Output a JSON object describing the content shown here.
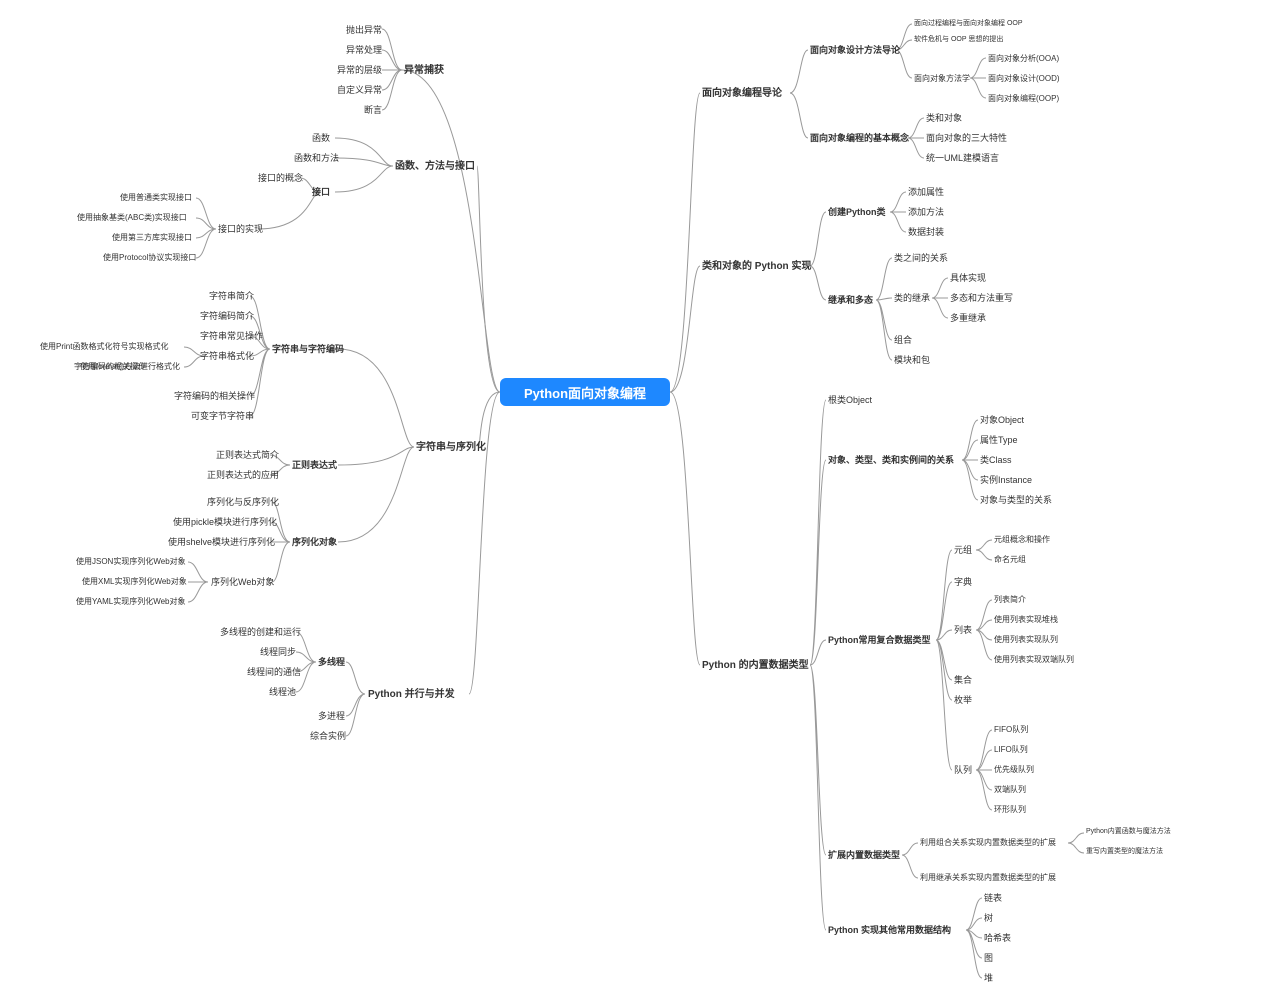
{
  "root": "Python面向对象编程",
  "L": {
    "b1": {
      "title": "异常捕获",
      "items": [
        "抛出异常",
        "异常处理",
        "异常的层级",
        "自定义异常",
        "断言"
      ]
    },
    "b2": {
      "title": "函数、方法与接口",
      "i1": "函数",
      "i2": "函数和方法",
      "i3": "接口",
      "i3a": "接口的概念",
      "i3b": "接口的实现",
      "i3b_items": [
        "使用普通类实现接口",
        "使用抽象基类(ABC类)实现接口",
        "使用第三方库实现接口",
        "使用Protocol协议实现接口"
      ]
    },
    "b3": {
      "title": "字符串与序列化",
      "s1": "字符串与字符编码",
      "s1_items": [
        "字符串简介",
        "字符编码简介",
        "字符串常见操作",
        "字符串格式化",
        "字符编码的相关操作",
        "可变字节字符串"
      ],
      "s1_fmt": [
        "使用Print函数格式化符号实现格式化",
        "使用format()方法进行格式化"
      ],
      "s2": "正则表达式",
      "s2_items": [
        "正则表达式简介",
        "正则表达式的应用"
      ],
      "s3": "序列化对象",
      "s3_items": [
        "序列化与反序列化",
        "使用pickle模块进行序列化",
        "使用shelve模块进行序列化",
        "序列化Web对象"
      ],
      "s3_web": [
        "使用JSON实现序列化Web对象",
        "使用XML实现序列化Web对象",
        "使用YAML实现序列化Web对象"
      ]
    },
    "b4": {
      "title": "Python 并行与并发",
      "i1": "多线程",
      "i1_items": [
        "多线程的创建和运行",
        "线程同步",
        "线程间的通信",
        "线程池"
      ],
      "i2": "多进程",
      "i3": "综合实例"
    }
  },
  "R": {
    "b1": {
      "title": "面向对象编程导论",
      "s1": "面向对象设计方法导论",
      "s1a": "面向过程编程与面向对象编程 OOP",
      "s1b": "软件危机与 OOP 思想的提出",
      "s1c": "面向对象方法学",
      "s1c_items": [
        "面向对象分析(OOA)",
        "面向对象设计(OOD)",
        "面向对象编程(OOP)"
      ],
      "s2": "面向对象编程的基本概念",
      "s2_items": [
        "类和对象",
        "面向对象的三大特性",
        "统一UML建模语言"
      ]
    },
    "b2": {
      "title": "类和对象的 Python 实现",
      "s1": "创建Python类",
      "s1_items": [
        "添加属性",
        "添加方法",
        "数据封装"
      ],
      "s2": "继承和多态",
      "s2a": "类之间的关系",
      "s2b": "类的继承",
      "s2b_items": [
        "具体实现",
        "多态和方法重写",
        "多重继承"
      ],
      "s2c": "组合",
      "s2d": "模块和包"
    },
    "b3": {
      "title": "Python 的内置数据类型",
      "s1": "根类Object",
      "s2": "对象、类型、类和实例间的关系",
      "s2_items": [
        "对象Object",
        "属性Type",
        "类Class",
        "实例Instance",
        "对象与类型的关系"
      ],
      "s3": "Python常用复合数据类型",
      "s3a": "元组",
      "s3a_items": [
        "元组概念和操作",
        "命名元组"
      ],
      "s3b": "字典",
      "s3c": "列表",
      "s3c_items": [
        "列表简介",
        "使用列表实现堆栈",
        "使用列表实现队列",
        "使用列表实现双端队列"
      ],
      "s3d": "集合",
      "s3e": "枚举",
      "s3f": "队列",
      "s3f_items": [
        "FIFO队列",
        "LIFO队列",
        "优先级队列",
        "双端队列",
        "环形队列"
      ],
      "s4": "扩展内置数据类型",
      "s4a": "利用组合关系实现内置数据类型的扩展",
      "s4a_items": [
        "Python内置函数与魔法方法",
        "重写内置类型的魔法方法"
      ],
      "s4b": "利用继承关系实现内置数据类型的扩展",
      "s5": "Python 实现其他常用数据结构",
      "s5_items": [
        "链表",
        "树",
        "哈希表",
        "图",
        "堆"
      ]
    }
  }
}
